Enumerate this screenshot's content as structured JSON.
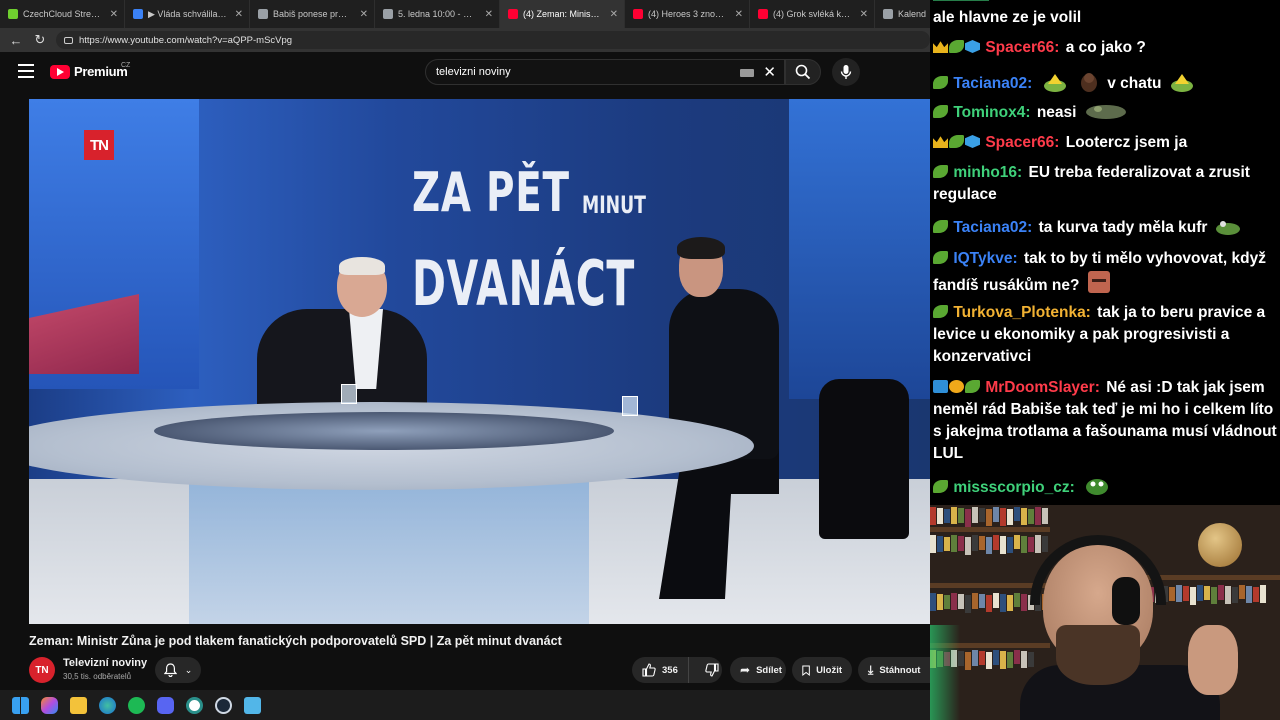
{
  "browser": {
    "tabs": [
      {
        "title": "CzechCloud Stream - Wa",
        "color": "#6fcf2f",
        "active": false
      },
      {
        "title": "▶ Vláda schválila progra",
        "color": "#3b82f6",
        "active": false
      },
      {
        "title": "Babiš ponese prezidento",
        "color": "#9aa0a6",
        "active": false
      },
      {
        "title": "5. ledna 10:00 - Studio C",
        "color": "#9aa0a6",
        "active": false
      },
      {
        "title": "(4) Zeman: Ministr Z",
        "color": "#ff0033",
        "active": true
      },
      {
        "title": "(4) Heroes 3 znovu přeic",
        "color": "#ff0033",
        "active": false
      },
      {
        "title": "(4) Grok svléká každého",
        "color": "#ff0033",
        "active": false
      },
      {
        "title": "Kalend",
        "color": "#9aa0a6",
        "active": false
      }
    ],
    "close_glyph": "✕",
    "url": "https://www.youtube.com/watch?v=aQPP-mScVpg"
  },
  "youtube": {
    "brand": "Premium",
    "region": "CZ",
    "search_value": "televizni noviny",
    "video": {
      "logo_text": "TN",
      "title_line1": "ZA PĚT",
      "title_minut": "MINUT",
      "title_line2": "DVANÁCT"
    },
    "video_title": "Zeman: Ministr Zůna je pod tlakem fanatických podporovatelů SPD | Za pět minut dvanáct",
    "channel": {
      "avatar_text": "TN",
      "name": "Televizní noviny",
      "subscribers": "30,5 tis. odběratelů"
    },
    "actions": {
      "likes": "356",
      "share": "Sdílet",
      "save": "Uložit",
      "download": "Stáhnout"
    }
  },
  "chat": {
    "messages": [
      {
        "user": "",
        "text": "ale hlavne ze je volil",
        "color": "#ffffff",
        "badges": []
      },
      {
        "user": "Spacer66:",
        "text": "a co jako ?",
        "color": "#ff3b4a",
        "badges": [
          "crown",
          "leaf",
          "cube"
        ]
      },
      {
        "user": "Taciana02:",
        "text": "v chatu",
        "color": "#3b82f6",
        "badges": [
          "leaf"
        ]
      },
      {
        "user": "Tominox4:",
        "text": "neasi",
        "color": "#3fd17a",
        "badges": [
          "leaf"
        ]
      },
      {
        "user": "Spacer66:",
        "text": "Lootercz jsem ja",
        "color": "#ff3b4a",
        "badges": [
          "crown",
          "leaf",
          "cube"
        ]
      },
      {
        "user": "minho16:",
        "text": "EU treba federalizovat a zrusit regulace",
        "color": "#3fd17a",
        "badges": [
          "leaf"
        ]
      },
      {
        "user": "Taciana02:",
        "text": "ta kurva tady měla kufr",
        "color": "#3b82f6",
        "badges": [
          "leaf"
        ]
      },
      {
        "user": "IQTykve:",
        "text": "tak to by ti mělo vyhovovat, když fandíš rusákům ne?",
        "color": "#3b82f6",
        "badges": [
          "leaf"
        ]
      },
      {
        "user": "Turkova_Plotenka:",
        "text": "tak ja to beru pravice a levice u ekonomiky a pak progresivisti a konzervativci",
        "color": "#f2b233",
        "badges": [
          "leaf"
        ]
      },
      {
        "user": "MrDoomSlayer:",
        "text": "Né asi :D tak jak jsem neměl rád Babiše tak teď je mi ho i celkem líto s jakejma trotlama a fašounama musí vládnout LUL",
        "color": "#ff3b4a",
        "badges": [
          "gift",
          "coin",
          "leaf"
        ]
      },
      {
        "user": "missscorpio_cz:",
        "text": "",
        "color": "#3fd17a",
        "badges": [
          "leaf"
        ]
      }
    ]
  }
}
